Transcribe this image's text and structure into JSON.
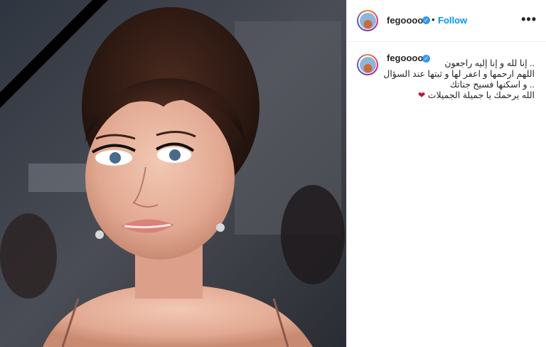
{
  "post": {
    "username": "fegoooo",
    "follow_label": "Follow",
    "separator": "•",
    "more_label": "•••",
    "verified_glyph": "✓",
    "caption": {
      "line1": ".. إنا لله و إنا إليه راجعون",
      "line2": "اللهم ارحمها و اعفر لها و ثبتها عند السؤال",
      "line3": ".. و اسكنها فسيح جناتك",
      "line4_text": "الله يرحمك يا جميلة الجميلات",
      "line4_emoji": "❤"
    }
  },
  "icons": {
    "verified": "verified-badge-icon",
    "more": "more-options-icon",
    "heart": "heart-icon",
    "mourning_ribbon": "mourning-ribbon-icon"
  },
  "colors": {
    "follow": "#0095f6",
    "verified": "#3897f0",
    "heart": "#c0183b",
    "text": "#262626"
  }
}
